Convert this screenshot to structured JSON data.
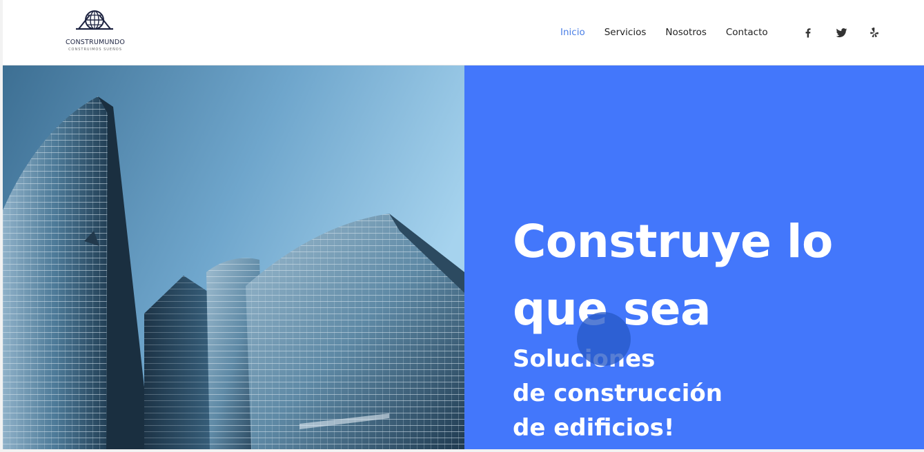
{
  "brand": {
    "name": "CONSTRUMUNDO",
    "tagline": "CONSTRUIMOS SUEÑOS",
    "logo_icon": "globe-roof-icon"
  },
  "nav": {
    "items": [
      {
        "label": "Inicio",
        "active": true
      },
      {
        "label": "Servicios",
        "active": false
      },
      {
        "label": "Nosotros",
        "active": false
      },
      {
        "label": "Contacto",
        "active": false
      }
    ]
  },
  "social": {
    "icons": [
      "facebook-icon",
      "twitter-icon",
      "yelp-icon"
    ]
  },
  "hero": {
    "headline": "Construye lo que sea",
    "subheadline_lines": [
      "Soluciones",
      "de construcción",
      "de edificios!"
    ],
    "image": "glass-skyscrapers-photo"
  },
  "colors": {
    "accent": "#4377fb",
    "active_link": "#4a7fe6",
    "text_dark": "#222222",
    "cursor_overlay": "#285ac8"
  }
}
